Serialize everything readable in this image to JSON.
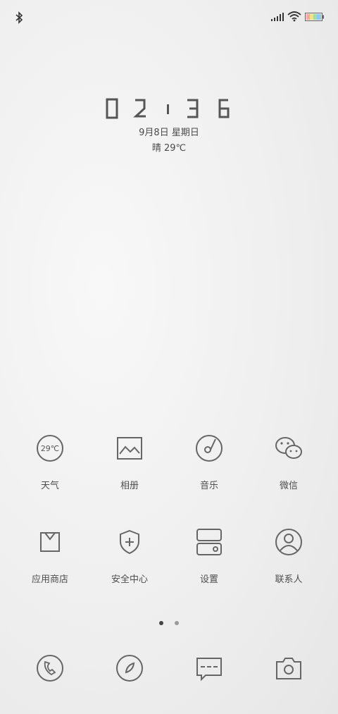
{
  "status": {
    "icons": [
      "bluetooth-icon",
      "signal-icon",
      "wifi-icon",
      "battery-icon"
    ],
    "battery_colors": [
      "#f7a7a7",
      "#f7e27a",
      "#9be0a4",
      "#8fc9f2"
    ]
  },
  "lockscreen": {
    "time": "02:36",
    "date": "9月8日 星期日",
    "weather": "晴 29℃"
  },
  "apps": [
    {
      "label": "天气",
      "icon": "weather-icon",
      "badge": "29℃"
    },
    {
      "label": "相册",
      "icon": "gallery-icon"
    },
    {
      "label": "音乐",
      "icon": "music-icon"
    },
    {
      "label": "微信",
      "icon": "wechat-icon"
    },
    {
      "label": "应用商店",
      "icon": "app-store-icon"
    },
    {
      "label": "安全中心",
      "icon": "security-shield-icon"
    },
    {
      "label": "设置",
      "icon": "settings-icon"
    },
    {
      "label": "联系人",
      "icon": "contacts-icon"
    }
  ],
  "page_indicator": {
    "current": 1,
    "total": 2
  },
  "dock": [
    {
      "icon": "phone-icon"
    },
    {
      "icon": "browser-compass-icon"
    },
    {
      "icon": "messages-icon"
    },
    {
      "icon": "camera-icon"
    }
  ],
  "colors": {
    "icon_stroke": "#666666",
    "dot_active": "#444444",
    "dot_inactive": "#9a9a9a"
  }
}
